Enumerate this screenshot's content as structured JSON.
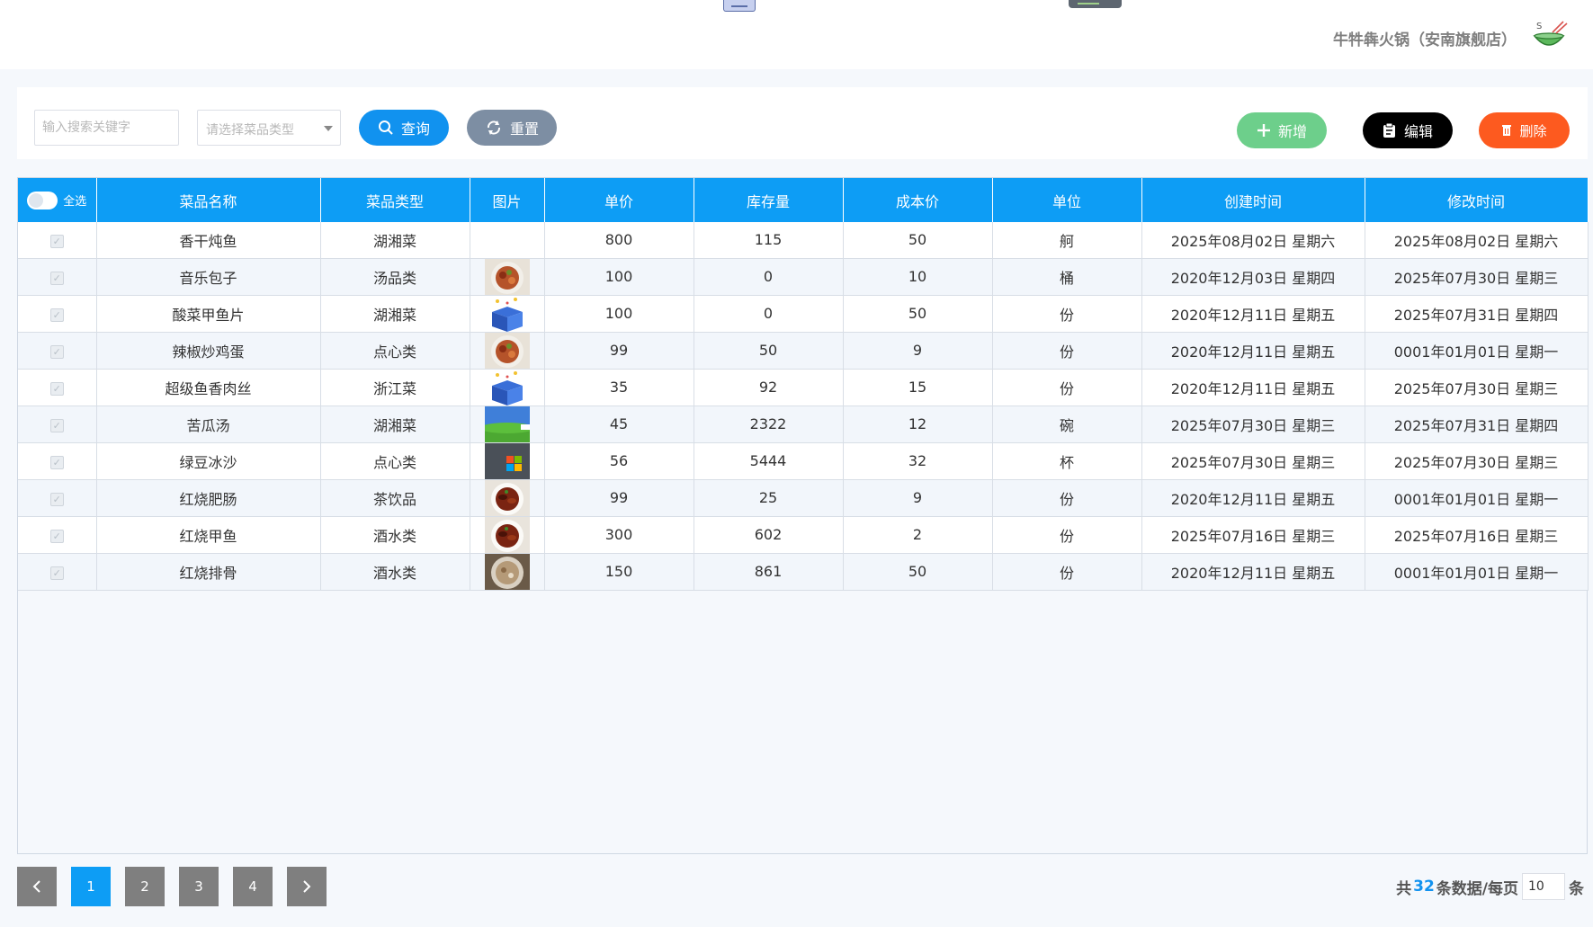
{
  "header": {
    "store_name": "牛牪犇火锅（安南旗舰店）"
  },
  "toolbar": {
    "search_placeholder": "输入搜索关键字",
    "type_placeholder": "请选择菜品类型",
    "query_label": "查询",
    "reset_label": "重置",
    "add_label": "新增",
    "edit_label": "编辑",
    "delete_label": "删除"
  },
  "table": {
    "select_all_label": "全选",
    "columns": [
      "菜品名称",
      "菜品类型",
      "图片",
      "单价",
      "库存量",
      "成本价",
      "单位",
      "创建时间",
      "修改时间"
    ],
    "rows": [
      {
        "name": "香干炖鱼",
        "type": "湖湘菜",
        "image": "none",
        "price": "800",
        "stock": "115",
        "cost": "50",
        "unit": "舸",
        "created": "2025年08月02日 星期六",
        "modified": "2025年08月02日 星期六"
      },
      {
        "name": "音乐包子",
        "type": "汤品类",
        "image": "food-dish",
        "price": "100",
        "stock": "0",
        "cost": "10",
        "unit": "桶",
        "created": "2020年12月03日 星期四",
        "modified": "2025年07月30日 星期三"
      },
      {
        "name": "酸菜甲鱼片",
        "type": "湖湘菜",
        "image": "blue-box",
        "price": "100",
        "stock": "0",
        "cost": "50",
        "unit": "份",
        "created": "2020年12月11日 星期五",
        "modified": "2025年07月31日 星期四"
      },
      {
        "name": "辣椒炒鸡蛋",
        "type": "点心类",
        "image": "food-dish",
        "price": "99",
        "stock": "50",
        "cost": "9",
        "unit": "份",
        "created": "2020年12月11日 星期五",
        "modified": "0001年01月01日 星期一"
      },
      {
        "name": "超级鱼香肉丝",
        "type": "浙江菜",
        "image": "blue-box",
        "price": "35",
        "stock": "92",
        "cost": "15",
        "unit": "份",
        "created": "2020年12月11日 星期五",
        "modified": "2025年07月30日 星期三"
      },
      {
        "name": "苦瓜汤",
        "type": "湖湘菜",
        "image": "landscape",
        "price": "45",
        "stock": "2322",
        "cost": "12",
        "unit": "碗",
        "created": "2025年07月30日 星期三",
        "modified": "2025年07月31日 星期四"
      },
      {
        "name": "绿豆冰沙",
        "type": "点心类",
        "image": "windows-logo",
        "price": "56",
        "stock": "5444",
        "cost": "32",
        "unit": "杯",
        "created": "2025年07月30日 星期三",
        "modified": "2025年07月30日 星期三"
      },
      {
        "name": "红烧肥肠",
        "type": "茶饮品",
        "image": "braised-dish",
        "price": "99",
        "stock": "25",
        "cost": "9",
        "unit": "份",
        "created": "2020年12月11日 星期五",
        "modified": "0001年01月01日 星期一"
      },
      {
        "name": "红烧甲鱼",
        "type": "酒水类",
        "image": "braised-dish",
        "price": "300",
        "stock": "602",
        "cost": "2",
        "unit": "份",
        "created": "2025年07月16日 星期三",
        "modified": "2025年07月16日 星期三"
      },
      {
        "name": "红烧排骨",
        "type": "酒水类",
        "image": "rice-dish",
        "price": "150",
        "stock": "861",
        "cost": "50",
        "unit": "份",
        "created": "2020年12月11日 星期五",
        "modified": "0001年01月01日 星期一"
      }
    ]
  },
  "pagination": {
    "pages": [
      "1",
      "2",
      "3",
      "4"
    ],
    "current": "1",
    "prev_icon": "chevron-left-icon",
    "next_icon": "chevron-right-icon",
    "total_prefix": "共",
    "total": "32",
    "total_suffix": "条数据/每页",
    "per_page": "10",
    "per_page_suffix": "条"
  },
  "colors": {
    "primary": "#0d9df5",
    "add": "#6dcf8b",
    "edit": "#000000",
    "delete": "#fd5a1f",
    "reset": "#7d8ea3"
  }
}
